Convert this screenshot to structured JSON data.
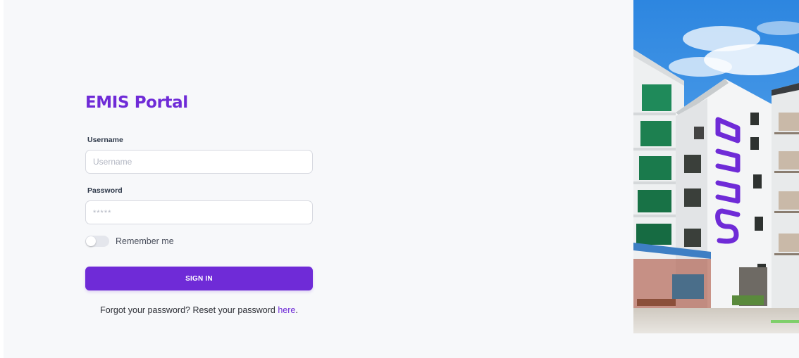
{
  "app": {
    "title": "EMIS Portal"
  },
  "form": {
    "username_label": "Username",
    "username_placeholder": "Username",
    "username_value": "",
    "password_label": "Password",
    "password_placeholder": "*****",
    "password_value": "",
    "remember_label": "Remember me",
    "remember_checked": false,
    "signin_label": "SIGN IN",
    "forgot_prefix": "Forgot your password? Reset your password ",
    "forgot_link": "here",
    "forgot_suffix": "."
  },
  "image": {
    "sign_text": "NUUS"
  },
  "colors": {
    "accent": "#6f2bd7",
    "background": "#f7f8fa",
    "sky": "#3a8fe3"
  }
}
